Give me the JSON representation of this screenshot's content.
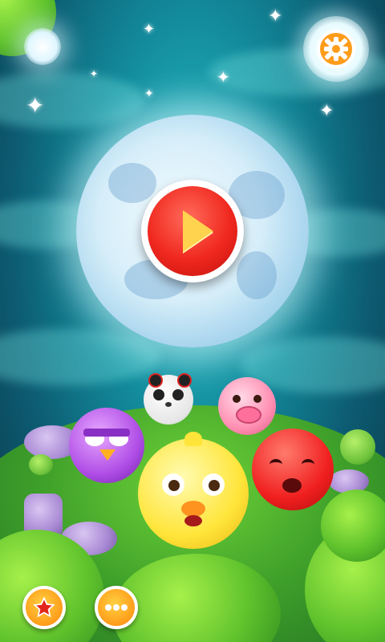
{
  "screen": {
    "name": "game-title-screen",
    "colors": {
      "sky": "#138c9d",
      "moon": "#d6eef9",
      "play_button": "#f0281f",
      "play_triangle": "#ffd34d",
      "menu_button": "#ff9c1a",
      "grass": "#3e9f2a"
    }
  },
  "buttons": {
    "play": {
      "icon": "play-icon"
    },
    "settings": {
      "icon": "gear-icon"
    },
    "rate": {
      "icon": "star-icon"
    },
    "more": {
      "icon": "ellipsis-icon"
    }
  },
  "characters": [
    "panda",
    "pig",
    "purple-bird",
    "yellow-chick",
    "red-ball"
  ]
}
